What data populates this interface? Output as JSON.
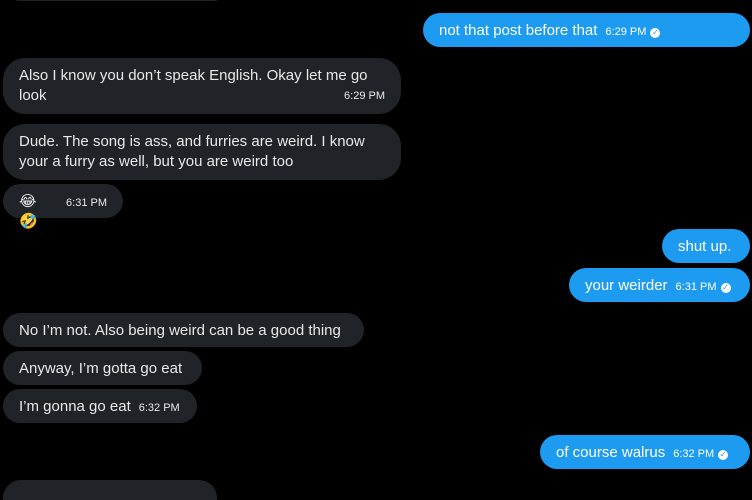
{
  "messages": [
    {
      "dir": "out",
      "text": "not that post before that",
      "time": "6:29 PM"
    },
    {
      "dir": "in",
      "text": "Also I know you don’t speak English. Okay let me go look",
      "time": "6:29 PM"
    },
    {
      "dir": "in",
      "text": "Dude. The song is ass, and furries are weird. I know your a furry as well, but you are weird too",
      "time": ""
    },
    {
      "dir": "in",
      "text": "😂 🤣",
      "time": "6:31 PM"
    },
    {
      "dir": "out",
      "text": "shut up.",
      "time": ""
    },
    {
      "dir": "out",
      "text": "your weirder",
      "time": "6:31 PM"
    },
    {
      "dir": "in",
      "text": "No I’m not. Also being weird can be a good thing",
      "time": ""
    },
    {
      "dir": "in",
      "text": "Anyway, I’m gotta go eat",
      "time": ""
    },
    {
      "dir": "in",
      "text": "I’m gonna go eat",
      "time": "6:32 PM"
    },
    {
      "dir": "out",
      "text": "of course walrus",
      "time": "6:32 PM"
    }
  ],
  "colors": {
    "incoming": "#202327",
    "outgoing": "#1d9bf0",
    "background": "#000000"
  },
  "icons": {
    "sent_status": "check-circle-icon"
  }
}
